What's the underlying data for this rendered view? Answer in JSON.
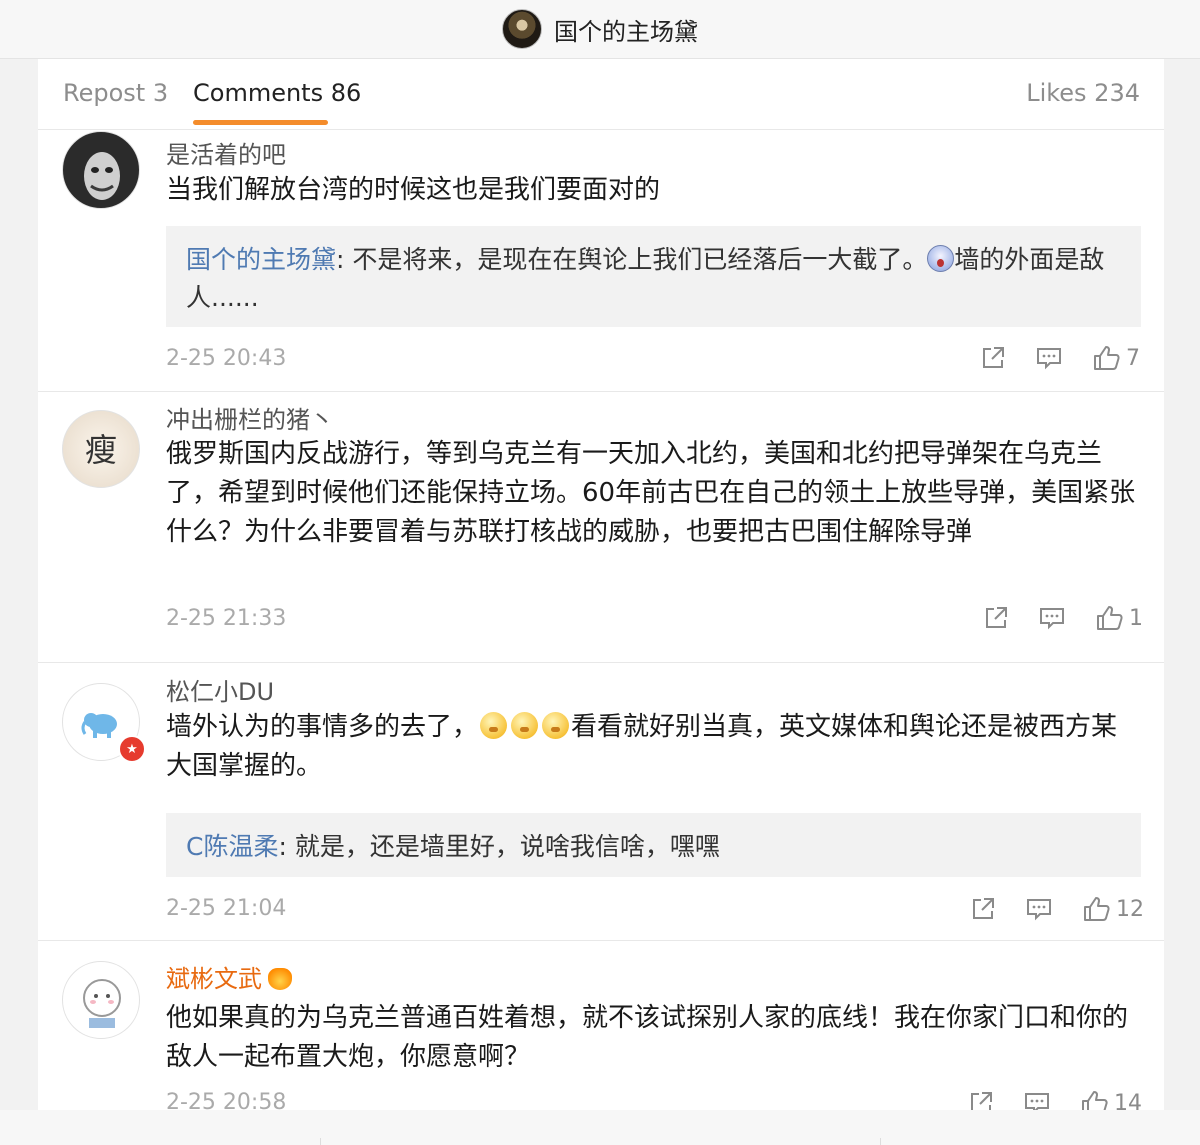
{
  "header": {
    "title": "国个的主场黛"
  },
  "tabs": {
    "repost": "Repost 3",
    "comments": "Comments 86",
    "likes": "Likes 234"
  },
  "comments": [
    {
      "username": "是活着的吧",
      "text": "当我们解放台湾的时候这也是我们要面对的",
      "reply": {
        "name": "国个的主场黛",
        "text_before_emoji": ": 不是将来，是现在在舆论上我们已经落后一大截了。",
        "text_after_emoji": "墙的外面是敌人......"
      },
      "time": "2-25 20:43",
      "likes": "7"
    },
    {
      "username": "冲出栅栏的猪丶",
      "avatar_char": "瘦",
      "text": "俄罗斯国内反战游行，等到乌克兰有一天加入北约，美国和北约把导弹架在乌克兰了，希望到时候他们还能保持立场。60年前古巴在自己的领土上放些导弹，美国紧张什么？为什么非要冒着与苏联打核战的威胁，也要把古巴围住解除导弹",
      "time": "2-25 21:33",
      "likes": "1"
    },
    {
      "username": "松仁小DU",
      "text_before_emoji": "墙外认为的事情多的去了，",
      "text_after_emoji": "看看就好别当真，英文媒体和舆论还是被西方某大国掌握的。",
      "reply": {
        "name": "C陈温柔",
        "text": ": 就是，还是墙里好，说啥我信啥，嘿嘿"
      },
      "time": "2-25 21:04",
      "likes": "12"
    },
    {
      "username": "斌彬文武",
      "text": "他如果真的为乌克兰普通百姓着想，就不该试探别人家的底线！我在你家门口和你的敌人一起布置大炮，你愿意啊？",
      "time": "2-25 20:58",
      "likes": "14"
    }
  ]
}
